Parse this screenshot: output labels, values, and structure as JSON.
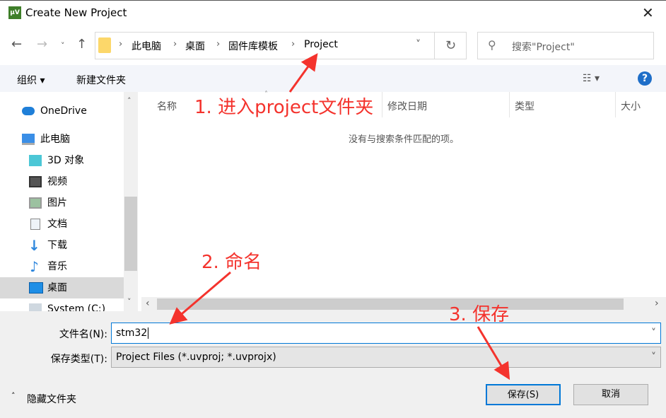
{
  "window": {
    "title": "Create New Project",
    "logo_text": "µV"
  },
  "address": {
    "crumbs": [
      "此电脑",
      "桌面",
      "固件库模板",
      "Project"
    ],
    "search_placeholder": "搜索\"Project\""
  },
  "toolbar": {
    "organize": "组织 ▾",
    "new_folder": "新建文件夹",
    "help": "?"
  },
  "nav_pane": {
    "items": [
      "OneDrive",
      "此电脑",
      "3D 对象",
      "视频",
      "图片",
      "文档",
      "下载",
      "音乐",
      "桌面",
      "System (C:)"
    ],
    "selected": "桌面"
  },
  "columns": [
    "名称",
    "修改日期",
    "类型",
    "大小"
  ],
  "empty_message": "没有与搜索条件匹配的项。",
  "form": {
    "filename_label": "文件名(N):",
    "filename_value": "stm32",
    "filetype_label": "保存类型(T):",
    "filetype_value": "Project Files (*.uvproj; *.uvprojx)"
  },
  "footer": {
    "hide_folders": "隐藏文件夹",
    "save": "保存(S)",
    "cancel": "取消"
  },
  "annotations": [
    "1. 进入project文件夹",
    "2. 命名",
    "3. 保存"
  ],
  "colors": {
    "annotation": "#f4332d",
    "accent": "#0078d7"
  }
}
